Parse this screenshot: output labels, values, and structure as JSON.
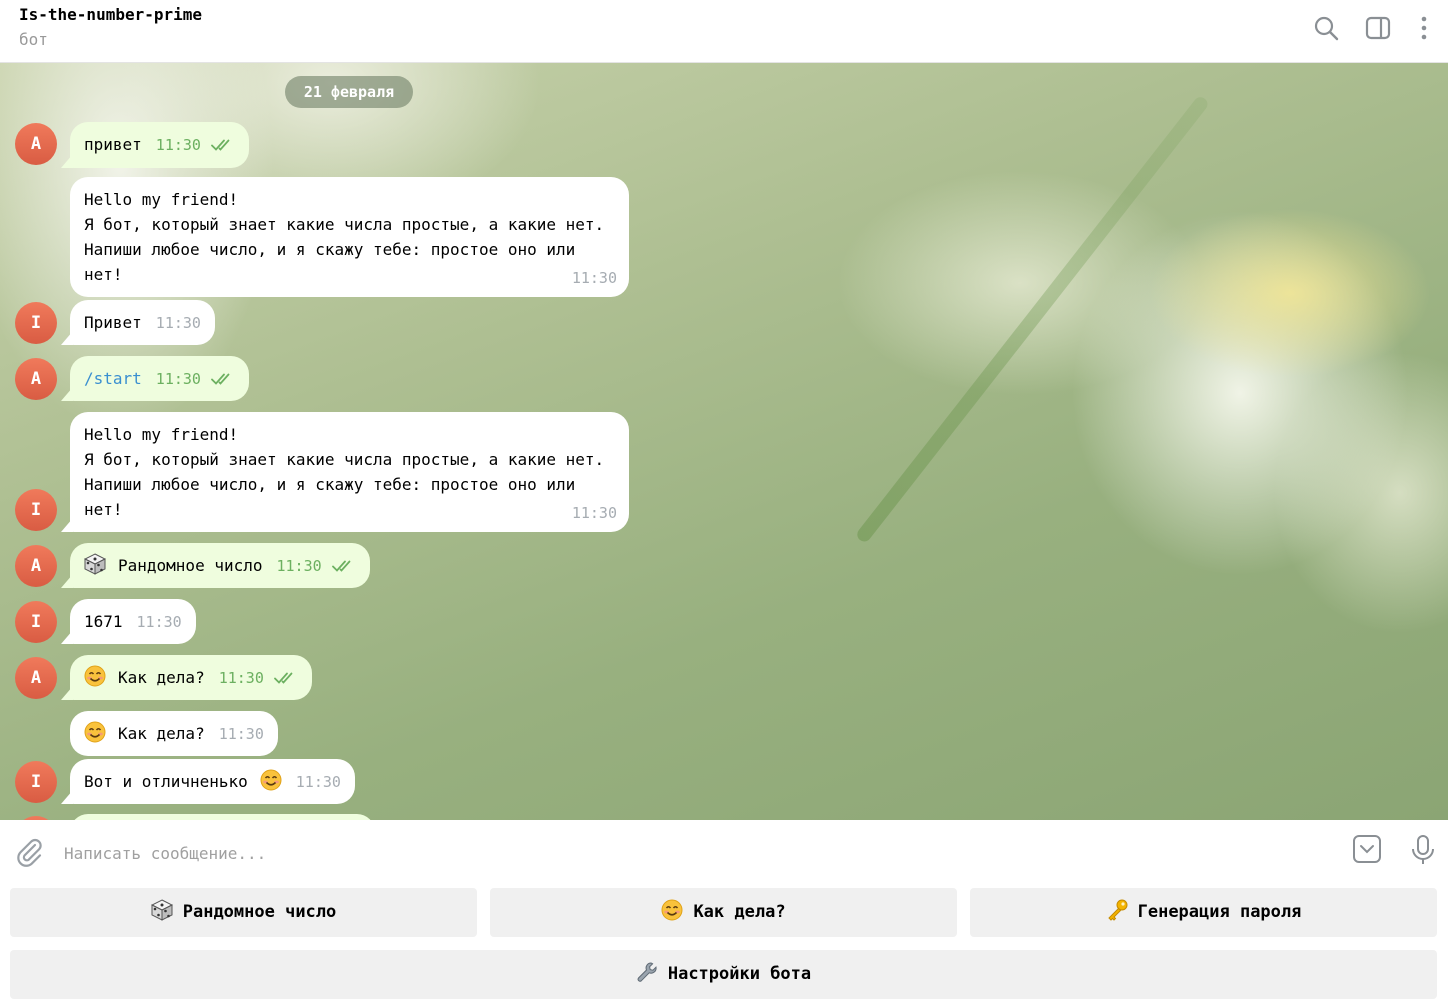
{
  "header": {
    "title": "Is-the-number-prime",
    "subtitle": "бот",
    "icons": [
      "search-icon",
      "side-panel-icon",
      "more-vertical-icon"
    ]
  },
  "chat": {
    "date_label": "21 февраля",
    "messages": [
      {
        "avatar": "A",
        "direction": "out",
        "text": "привет",
        "time": "11:30",
        "status": "read"
      },
      {
        "direction": "in",
        "lines": [
          "Hello my friend!",
          "Я бот, который знает какие числа простые, а какие нет.",
          "Напиши любое число, и я скажу тебе: простое оно или",
          "нет!"
        ],
        "time": "11:30"
      },
      {
        "avatar": "I",
        "direction": "in",
        "text": "Привет",
        "time": "11:30"
      },
      {
        "avatar": "A",
        "direction": "out",
        "text": "/start",
        "time": "11:30",
        "status": "read"
      },
      {
        "avatar": "I",
        "direction": "in",
        "lines": [
          "Hello my friend!",
          "Я бот, который знает какие числа простые, а какие нет.",
          "Напиши любое число, и я скажу тебе: простое оно или",
          "нет!"
        ],
        "time": "11:30"
      },
      {
        "avatar": "A",
        "direction": "out",
        "emoji": "game-die",
        "text": "Рандомное число",
        "time": "11:30",
        "status": "read"
      },
      {
        "avatar": "I",
        "direction": "in",
        "text": "1671",
        "time": "11:30"
      },
      {
        "avatar": "A",
        "direction": "out",
        "emoji": "smiling-face",
        "text": "Как дела?",
        "time": "11:30",
        "status": "read"
      },
      {
        "direction": "in",
        "emoji": "smiling-face",
        "text": "Как дела?",
        "time": "11:30"
      },
      {
        "avatar": "I",
        "direction": "in",
        "text": "Вот и отличненько",
        "trailing_emoji": "smiling-face",
        "time": "11:30"
      }
    ]
  },
  "composer": {
    "placeholder": "Написать сообщение...",
    "value": ""
  },
  "keyboard": {
    "buttons": [
      {
        "emoji": "game-die",
        "label": "Рандомное число"
      },
      {
        "emoji": "smiling-face",
        "label": "Как дела?"
      },
      {
        "emoji": "key",
        "label": "Генерация пароля"
      },
      {
        "emoji": "wrench",
        "label": "Настройки бота"
      }
    ]
  },
  "colors": {
    "outgoing_bubble": "#effdde",
    "incoming_bubble": "#ffffff",
    "avatar": "#e56a4f",
    "read_ticks": "#6cb060",
    "command_link": "#3a8fd0"
  }
}
